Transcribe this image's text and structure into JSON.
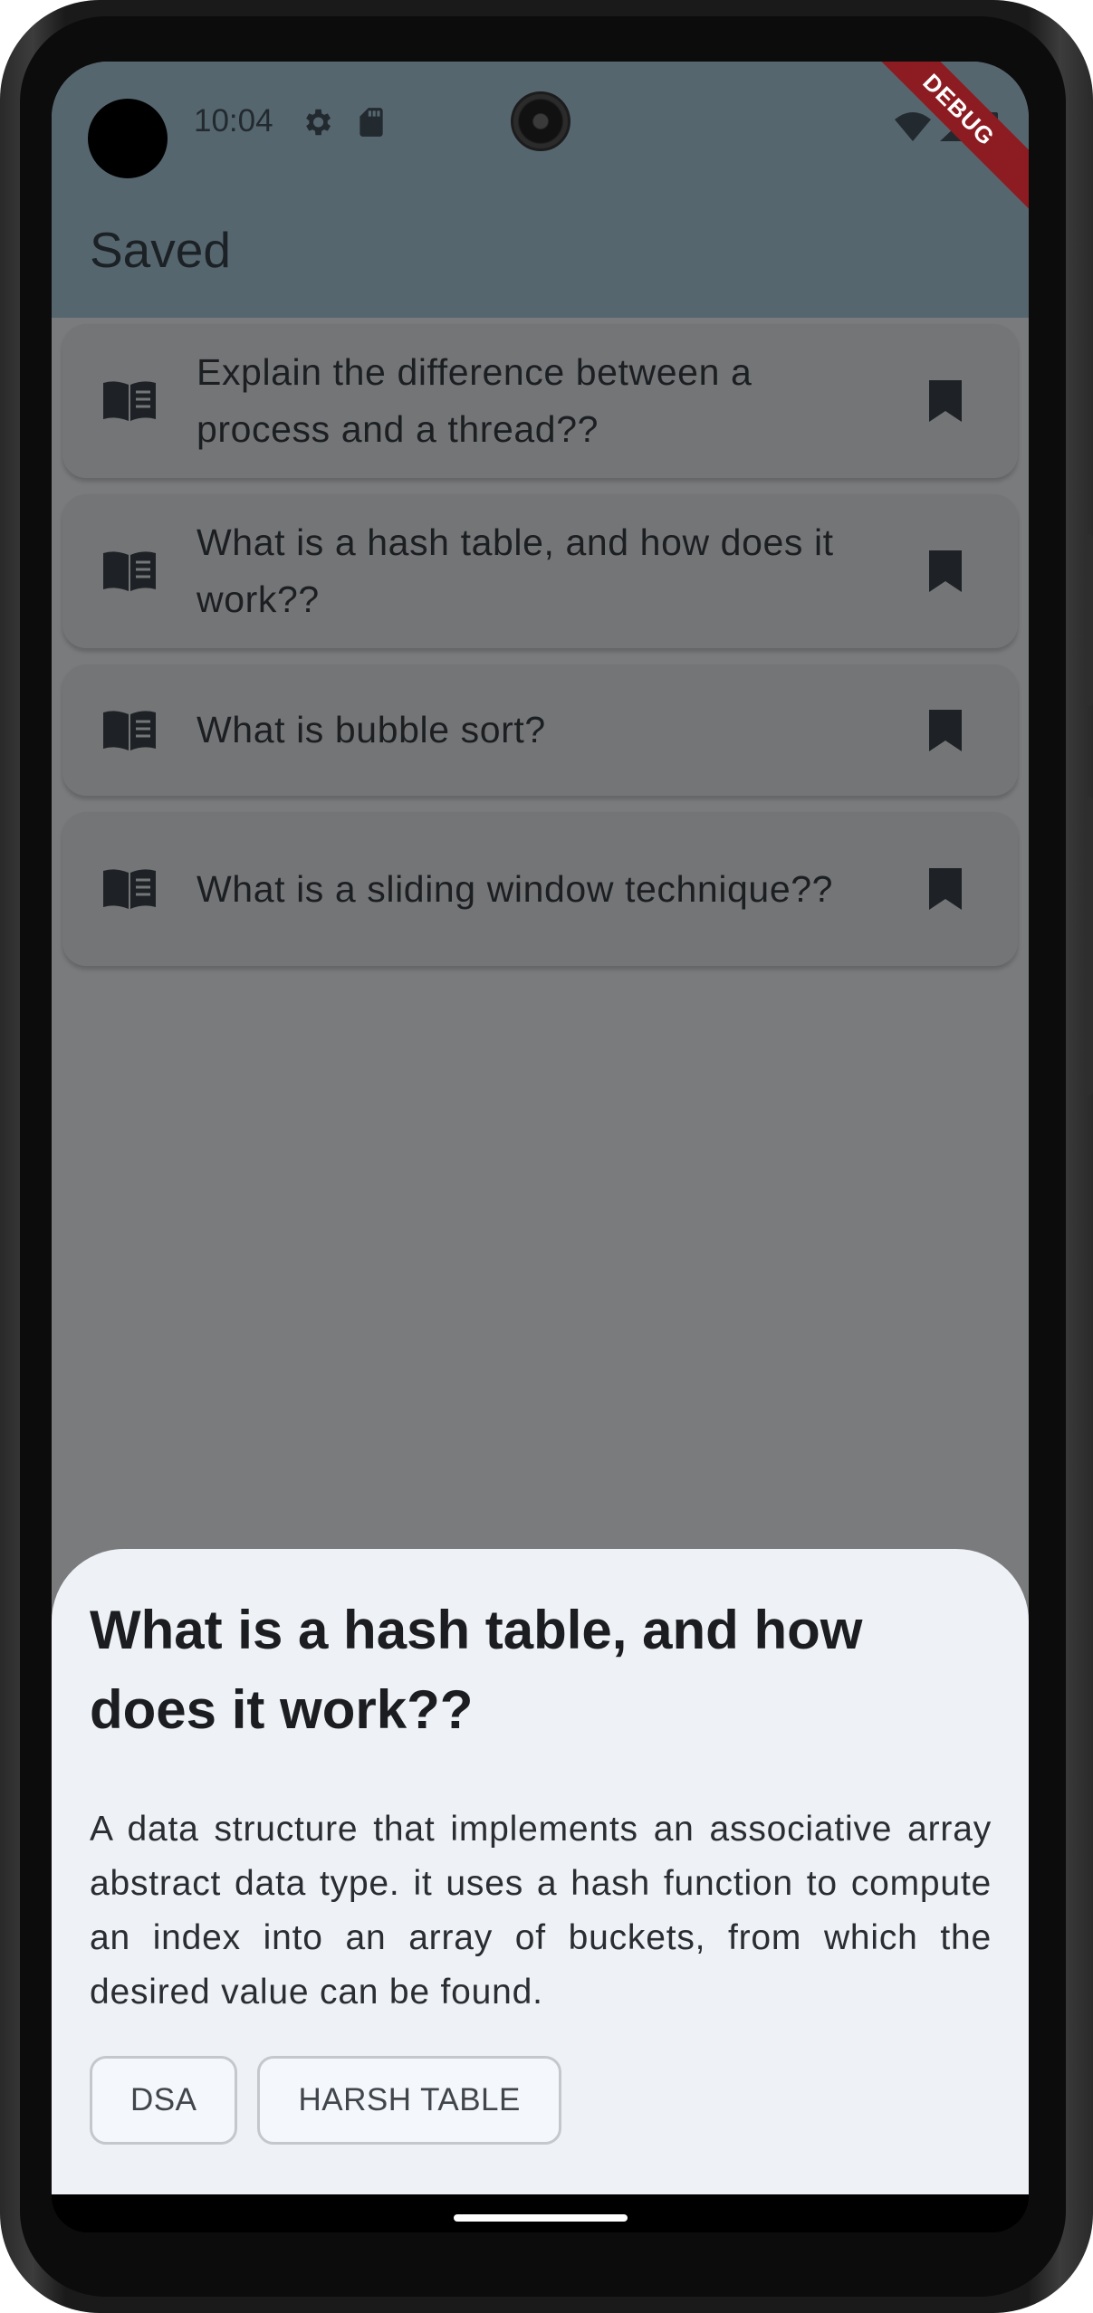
{
  "status_bar": {
    "time": "10:04",
    "debug_label": "DEBUG"
  },
  "app_bar": {
    "title": "Saved"
  },
  "saved_questions": [
    {
      "text": "Explain the difference between a process and a thread??",
      "lead_icon": "menu-book-icon",
      "trail_icon": "bookmark-icon"
    },
    {
      "text": "What is a hash table, and how does it work??",
      "lead_icon": "menu-book-icon",
      "trail_icon": "bookmark-icon"
    },
    {
      "text": "What is bubble sort?",
      "lead_icon": "menu-book-icon",
      "trail_icon": "bookmark-icon"
    },
    {
      "text": "What is a sliding window technique??",
      "lead_icon": "menu-book-icon",
      "trail_icon": "bookmark-icon"
    }
  ],
  "bottom_sheet": {
    "title": "What is a hash table, and how does it work??",
    "answer": "A data structure that implements an associative array abstract data type. it uses a hash function to compute an index into an array of buckets, from which the desired value can be found.",
    "tags": [
      "DSA",
      "HARSH TABLE"
    ]
  },
  "colors": {
    "app_bar": "#56666f",
    "scrim": "#7a7b7d",
    "card": "#747577",
    "sheet": "#eef1f6",
    "debug_ribbon": "#8c1c22"
  }
}
